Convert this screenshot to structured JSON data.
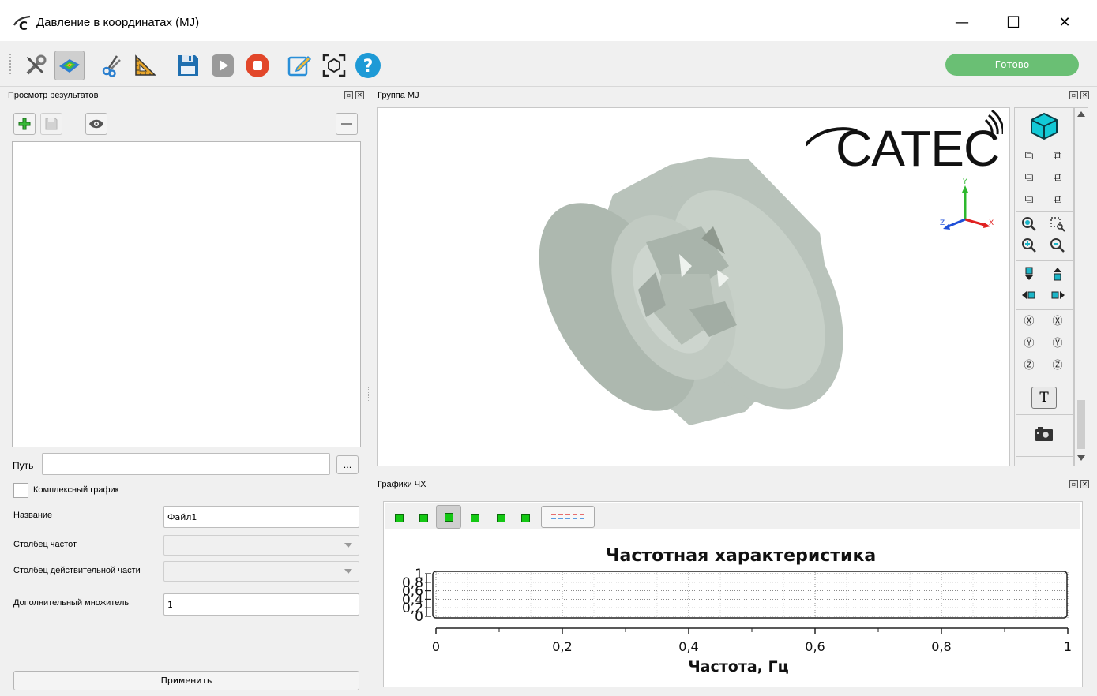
{
  "window": {
    "title": "Давление в координатах (MJ)",
    "minimize_glyph": "—",
    "maximize_glyph": "☐",
    "close_glyph": "✕"
  },
  "toolbar": {
    "status_label": "Готово",
    "status_color": "#6abf74",
    "icons": [
      "tools-icon",
      "results-map-icon",
      "cut-icon",
      "measure-triangle-icon",
      "save-icon",
      "play-icon",
      "stop-icon",
      "edit-icon",
      "fit-view-icon",
      "help-icon"
    ]
  },
  "results_panel": {
    "title": "Просмотр результатов",
    "path_label": "Путь",
    "path_value": "",
    "browse_label": "...",
    "complex_plot_label": "Комплексный график",
    "complex_plot_checked": false,
    "name_label": "Название",
    "name_value": "Файл1",
    "freq_column_label": "Столбец частот",
    "freq_column_value": "",
    "real_column_label": "Столбец действительной части",
    "real_column_value": "",
    "multiplier_label": "Дополнительный множитель",
    "multiplier_value": "1",
    "apply_label": "Применить"
  },
  "view_panel": {
    "title": "Группа MJ",
    "logo_text": "CATEC",
    "axes": {
      "x": "X",
      "y": "Y",
      "z": "Z"
    },
    "model_color": "#b9c3bb",
    "text_tool_label": "T"
  },
  "charts_panel": {
    "title": "Графики ЧХ"
  },
  "chart_data": {
    "type": "line",
    "title": "Частотная характеристика",
    "xlabel": "Частота, Гц",
    "ylabel": "",
    "xlim": [
      0,
      1
    ],
    "ylim": [
      0,
      1
    ],
    "x_ticks": [
      "0",
      "0,2",
      "0,4",
      "0,6",
      "0,8",
      "1"
    ],
    "y_ticks": [
      "0",
      "0,2",
      "0,4",
      "0,6",
      "0,8",
      "1"
    ],
    "grid": true,
    "series": []
  }
}
